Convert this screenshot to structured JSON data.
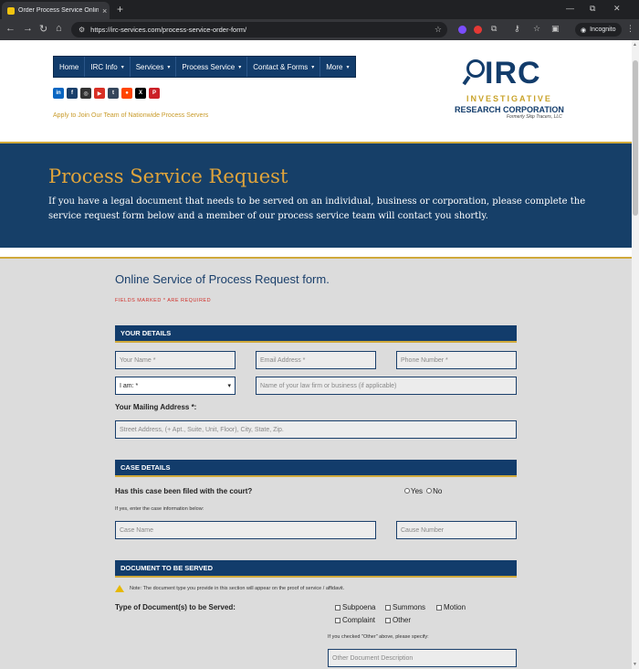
{
  "browser": {
    "tab_title": "Order Process Service Online -",
    "tab_close": "×",
    "new_tab": "+",
    "url": "https://irc-services.com/process-service-order-form/",
    "incognito": "Incognito",
    "win_min": "—",
    "win_restore": "⧉",
    "win_close": "✕"
  },
  "nav": {
    "items": [
      "Home",
      "IRC Info",
      "Services",
      "Process Service",
      "Contact & Forms",
      "More"
    ],
    "caret": "▾"
  },
  "socials": [
    {
      "label": "in",
      "color": "#0a66c2"
    },
    {
      "label": "f",
      "color": "#1a3f6b"
    },
    {
      "label": "◎",
      "color": "#333333"
    },
    {
      "label": "▶",
      "color": "#d93025"
    },
    {
      "label": "t",
      "color": "#35465c"
    },
    {
      "label": "●",
      "color": "#ff4500"
    },
    {
      "label": "X",
      "color": "#000000"
    },
    {
      "label": "P",
      "color": "#cb2027"
    }
  ],
  "join_link": "Apply to Join Our Team of Nationwide Process Servers",
  "logo": {
    "irc": "IRC",
    "investigative": "INVESTIGATIVE",
    "research": "RESEARCH CORPORATION",
    "former": "Formerly Skip Tracers, LLC"
  },
  "hero": {
    "title": "Process Service Request",
    "text": "If you have a legal document that needs to be served on an individual, business or corporation, please complete the service request form below and a member of our process service team will contact you shortly."
  },
  "form": {
    "title": "Online Service of Process Request form.",
    "required_note": "FIELDS MARKED * ARE REQUIRED",
    "your_details": {
      "heading": "YOUR DETAILS",
      "name_ph": "Your Name *",
      "email_ph": "Email Address *",
      "phone_ph": "Phone Number *",
      "i_am": "I am: *",
      "firm_ph": "Name of your law firm or business (if applicable)",
      "mailing_label": "Your Mailing Address *:",
      "street_ph": "Street Address, (+ Apt., Suite, Unit, Floor), City, State, Zip."
    },
    "case_details": {
      "heading": "CASE DETAILS",
      "question": "Has this case been filed with the court?",
      "yes": "Yes",
      "no": "No",
      "hint": "If yes, enter the case information below:",
      "case_name_ph": "Case Name",
      "case_number_ph": "Cause Number"
    },
    "document": {
      "heading": "DOCUMENT TO BE SERVED",
      "note": "Note: The document type you provide in this section will appear on the proof of service / affidavit.",
      "type_label": "Type of Document(s) to be Served:",
      "options": [
        "Subpoena",
        "Summons",
        "Motion",
        "Complaint",
        "Other"
      ],
      "other_hint": "If you checked \"Other\" above, please specify:",
      "other_ph": "Other Document Description"
    }
  }
}
